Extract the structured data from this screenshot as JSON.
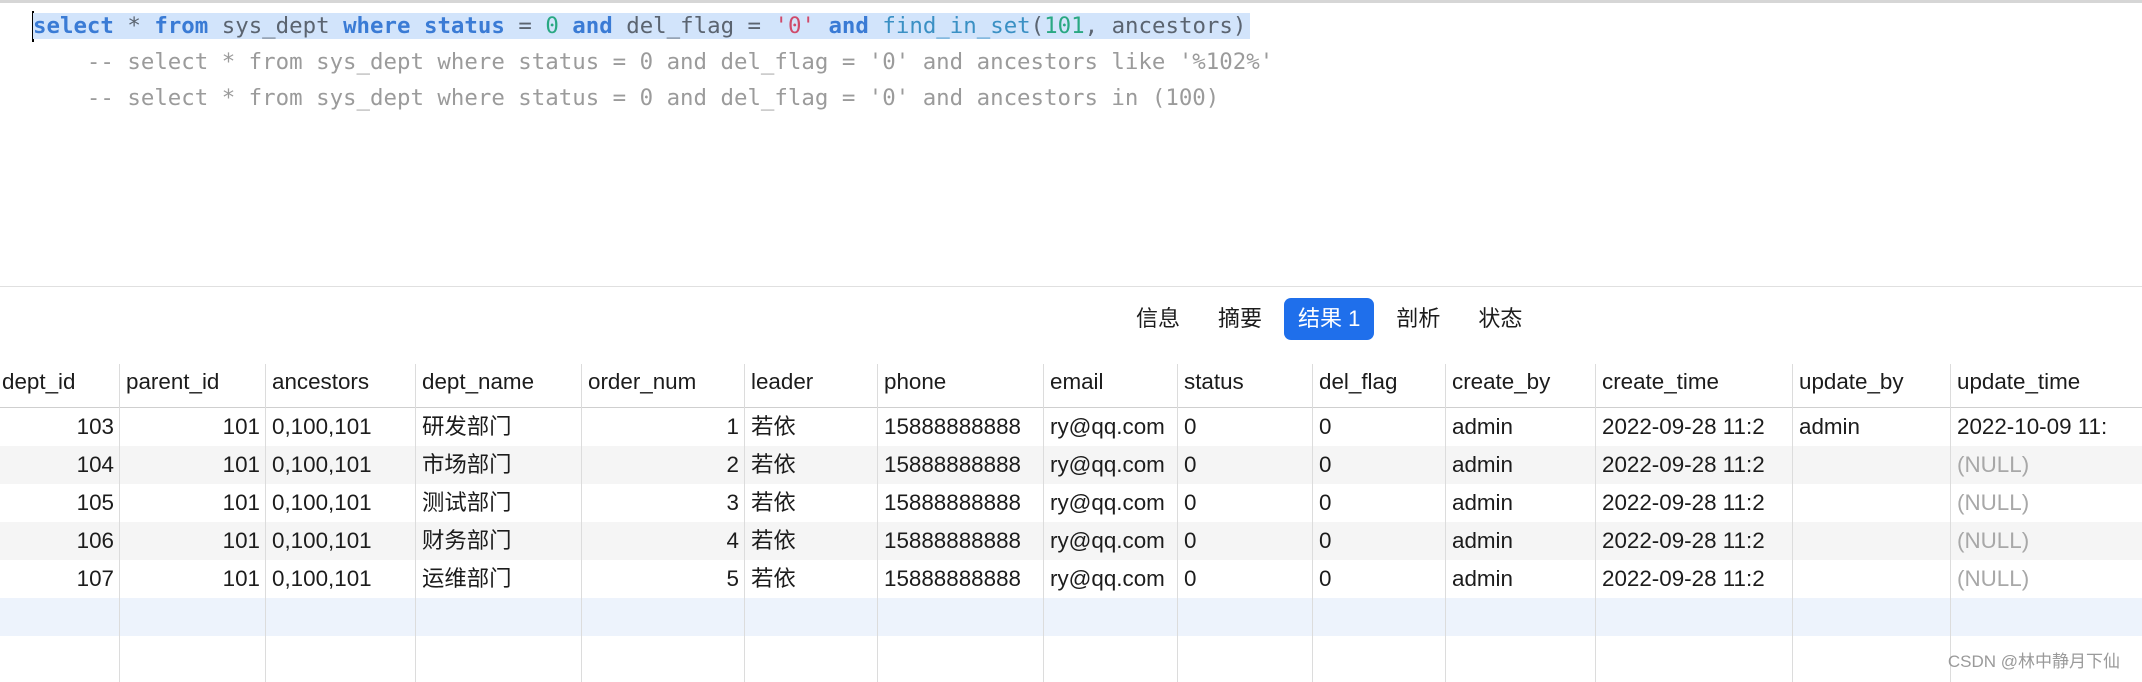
{
  "editor": {
    "line1": {
      "t1": "select",
      "t2": " * ",
      "t3": "from",
      "t4": " sys_dept ",
      "t5": "where",
      "t6": " ",
      "t7": "status",
      "t8": " = ",
      "t9": "0",
      "t10": " ",
      "t11": "and",
      "t12": " del_flag = ",
      "t13": "'0'",
      "t14": " ",
      "t15": "and",
      "t16": " ",
      "t17": "find_in_set",
      "t18": "(",
      "t19": "101",
      "t20": ", ancestors)"
    },
    "line2": "    -- select * from sys_dept where status = 0 and del_flag = '0' and ancestors like '%102%'",
    "line3": "    -- select * from sys_dept where status = 0 and del_flag = '0' and ancestors in (100)"
  },
  "tabs": [
    {
      "label": "信息"
    },
    {
      "label": "摘要"
    },
    {
      "label": "结果 1",
      "active": true
    },
    {
      "label": "剖析"
    },
    {
      "label": "状态"
    }
  ],
  "columns": [
    "dept_id",
    "parent_id",
    "ancestors",
    "dept_name",
    "order_num",
    "leader",
    "phone",
    "email",
    "status",
    "del_flag",
    "create_by",
    "create_time",
    "update_by",
    "update_time"
  ],
  "rows": [
    [
      "103",
      "101",
      "0,100,101",
      "研发部门",
      "1",
      "若依",
      "15888888888",
      "ry@qq.com",
      "0",
      "0",
      "admin",
      "2022-09-28 11:2",
      "admin",
      "2022-10-09 11:"
    ],
    [
      "104",
      "101",
      "0,100,101",
      "市场部门",
      "2",
      "若依",
      "15888888888",
      "ry@qq.com",
      "0",
      "0",
      "admin",
      "2022-09-28 11:2",
      "",
      "(NULL)"
    ],
    [
      "105",
      "101",
      "0,100,101",
      "测试部门",
      "3",
      "若依",
      "15888888888",
      "ry@qq.com",
      "0",
      "0",
      "admin",
      "2022-09-28 11:2",
      "",
      "(NULL)"
    ],
    [
      "106",
      "101",
      "0,100,101",
      "财务部门",
      "4",
      "若依",
      "15888888888",
      "ry@qq.com",
      "0",
      "0",
      "admin",
      "2022-09-28 11:2",
      "",
      "(NULL)"
    ],
    [
      "107",
      "101",
      "0,100,101",
      "运维部门",
      "5",
      "若依",
      "15888888888",
      "ry@qq.com",
      "0",
      "0",
      "admin",
      "2022-09-28 11:2",
      "",
      "(NULL)"
    ]
  ],
  "watermark": "CSDN @林中静月下仙"
}
